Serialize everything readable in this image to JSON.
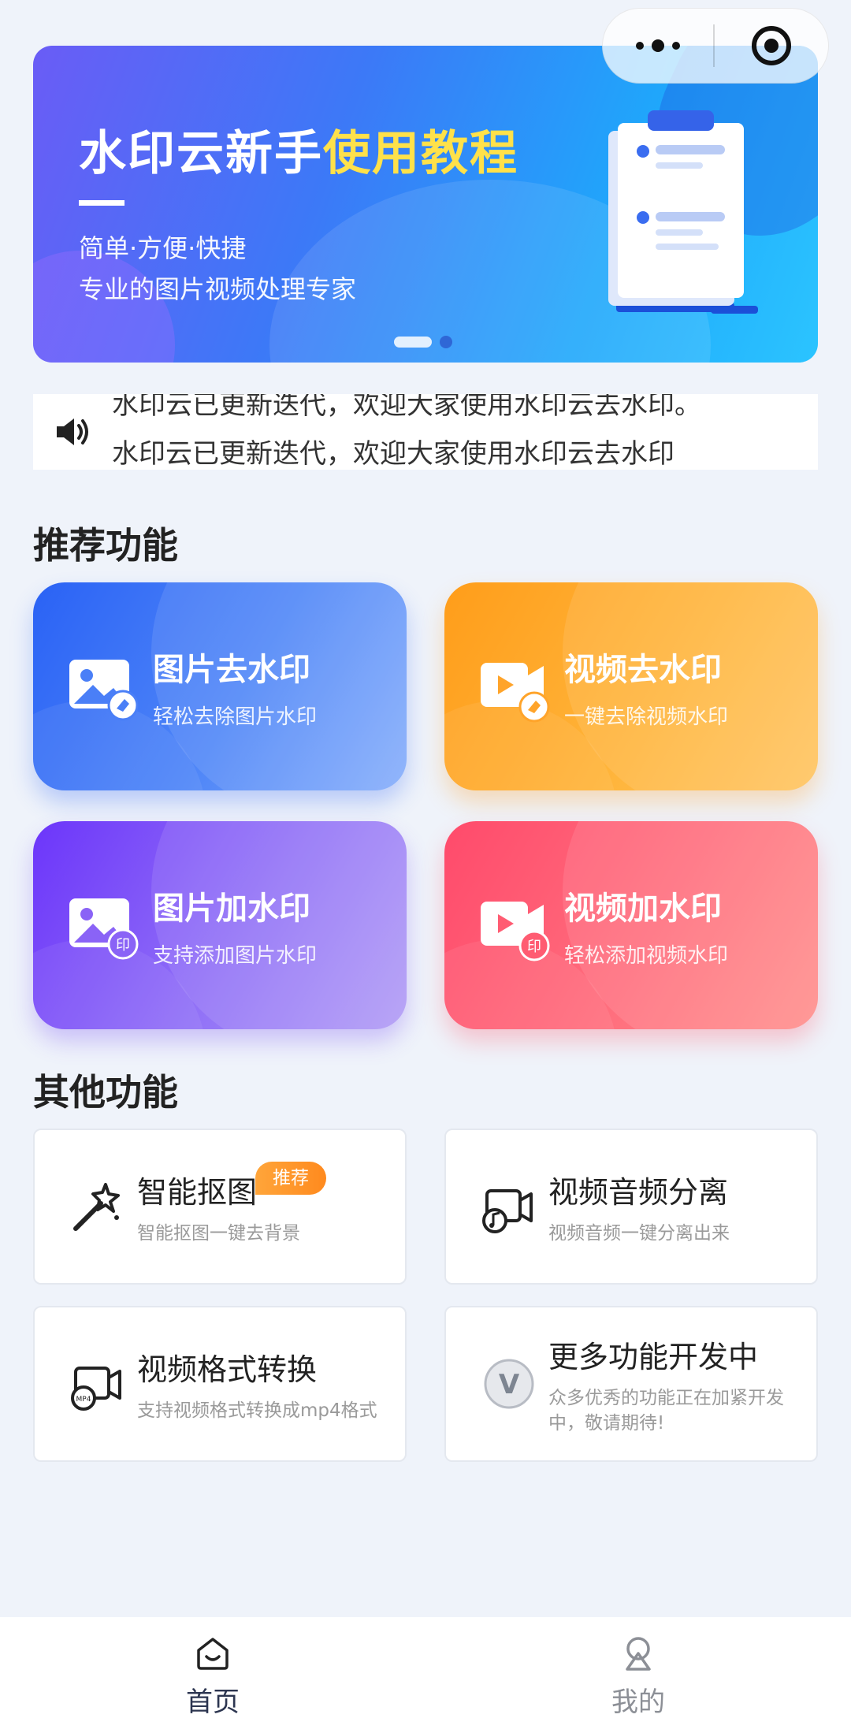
{
  "capsule": {
    "more_icon": "more-dots-icon",
    "close_icon": "target-circle-icon"
  },
  "banner": {
    "title_main": "水印云新手",
    "title_highlight": "使用教程",
    "line1": "简单·方便·快捷",
    "line2": "专业的图片视频处理专家",
    "slide_count": 2,
    "active_slide": 1
  },
  "notice": {
    "icon": "speaker-icon",
    "text_prev": "水印云已更新迭代，欢迎大家使用水印云去水印。",
    "text_next": "水印云已更新迭代，欢迎大家使用水印云去水印"
  },
  "recommend": {
    "title": "推荐功能",
    "items": [
      {
        "title": "图片去水印",
        "subtitle": "轻松去除图片水印"
      },
      {
        "title": "视频去水印",
        "subtitle": "一键去除视频水印"
      },
      {
        "title": "图片加水印",
        "subtitle": "支持添加图片水印"
      },
      {
        "title": "视频加水印",
        "subtitle": "轻松添加视频水印"
      }
    ]
  },
  "other": {
    "title": "其他功能",
    "items": [
      {
        "title": "智能抠图",
        "subtitle": "智能抠图一键去背景",
        "badge": "推荐"
      },
      {
        "title": "视频音频分离",
        "subtitle": "视频音频一键分离出来"
      },
      {
        "title": "视频格式转换",
        "subtitle": "支持视频格式转换成mp4格式"
      },
      {
        "title": "更多功能开发中",
        "subtitle": "众多优秀的功能正在加紧开发中，敬请期待!"
      }
    ]
  },
  "tabbar": {
    "items": [
      {
        "label": "首页",
        "icon": "home-icon",
        "active": true
      },
      {
        "label": "我的",
        "icon": "profile-icon",
        "active": false
      }
    ]
  },
  "colors": {
    "accent": "#2a62f5",
    "background": "#eff3fa",
    "badge": "#ff8a1e"
  }
}
